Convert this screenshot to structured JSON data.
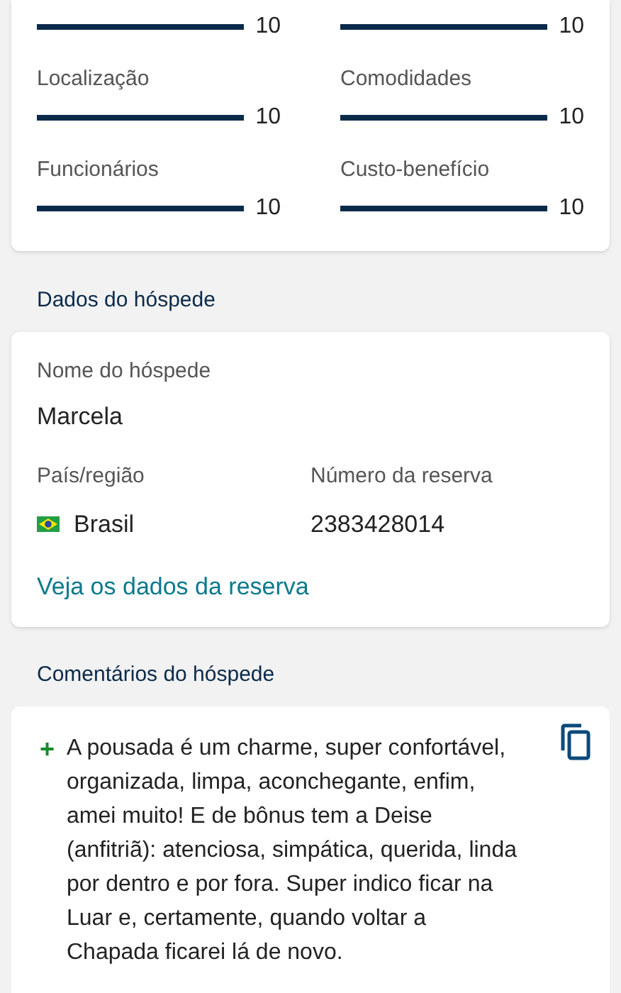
{
  "ratings": [
    {
      "score": "10",
      "level": 1
    },
    {
      "score": "10",
      "level": 1
    },
    {
      "label": "Localização",
      "score": "10",
      "level": 1
    },
    {
      "label": "Comodidades",
      "score": "10",
      "level": 1
    },
    {
      "label": "Funcionários",
      "score": "10",
      "level": 1
    },
    {
      "label": "Custo-benefício",
      "score": "10",
      "level": 1
    }
  ],
  "guest_section": {
    "title": "Dados do hóspede",
    "name_label": "Nome do hóspede",
    "name": "Marcela",
    "country_label": "País/região",
    "country": "Brasil",
    "booking_label": "Número da reserva",
    "booking_number": "2383428014",
    "link": "Veja os dados da reserva"
  },
  "comments_section": {
    "title": "Comentários do hóspede",
    "comments": [
      {
        "kind": "positive",
        "marker": "+",
        "text": "A pousada é um charme, super confortável, organizada, limpa, aconchegante, enfim, amei muito! E de bônus tem a Deise (anfitriã): atenciosa, simpática, querida, linda por dentro e por fora. Super indico ficar na Luar e, certamente, quando voltar a Chapada ficarei lá de novo."
      }
    ]
  }
}
